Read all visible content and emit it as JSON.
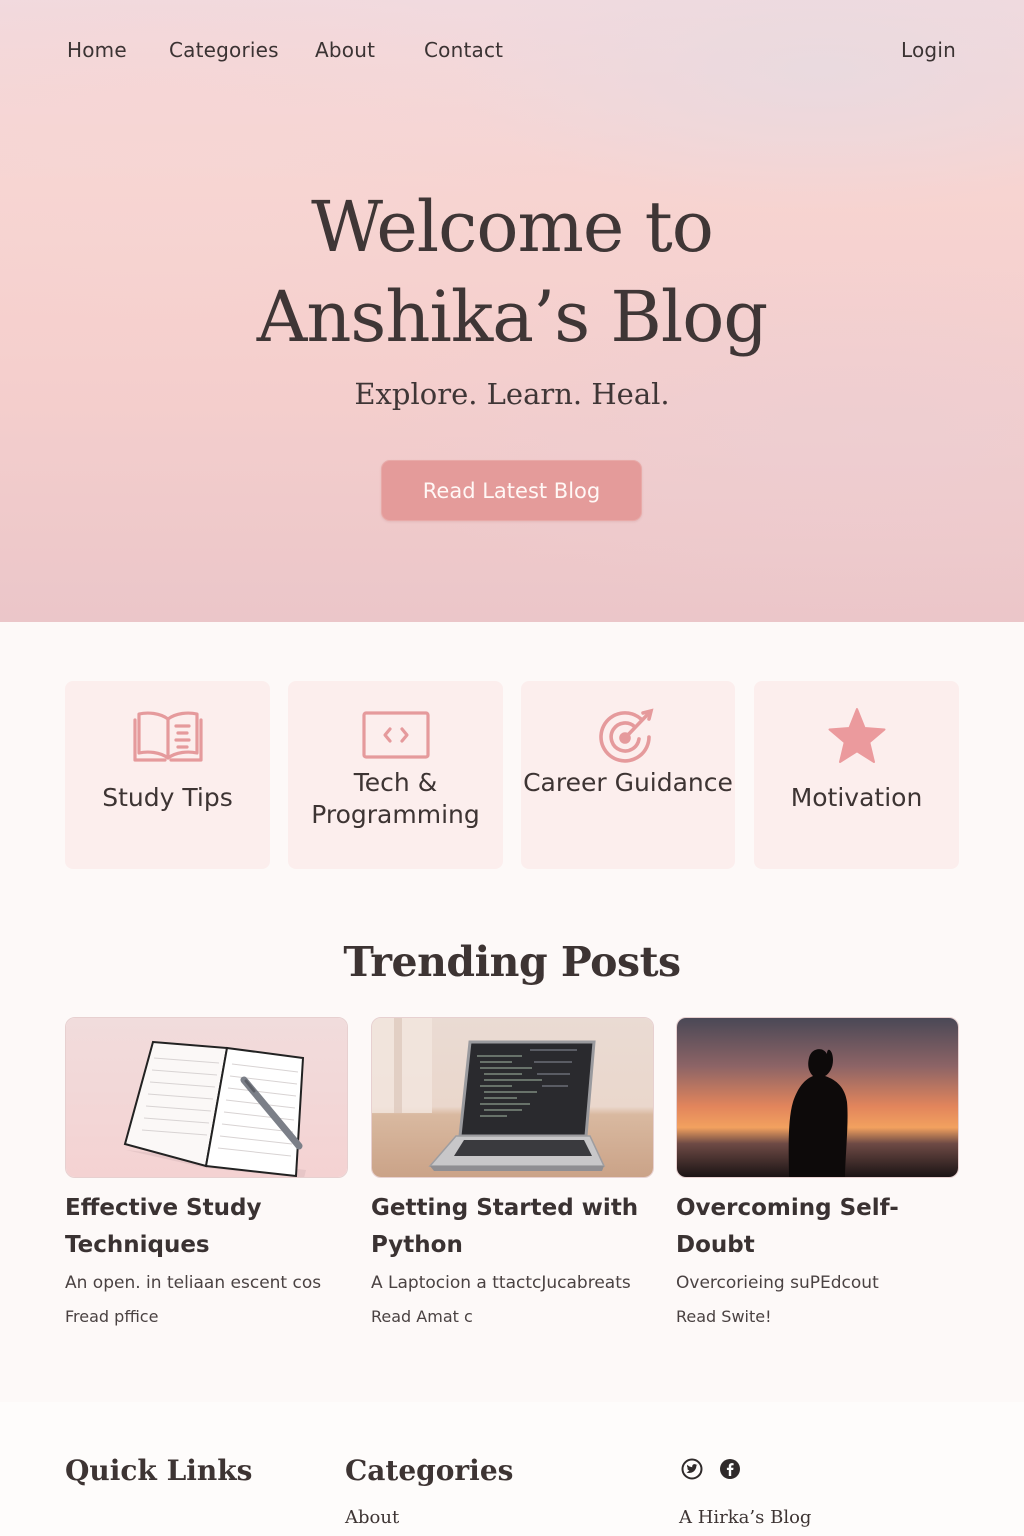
{
  "nav": {
    "items": [
      "Home",
      "Categories",
      "About",
      "Contact"
    ],
    "login": "Login"
  },
  "hero": {
    "title_line1": "Welcome to",
    "title_line2": "Anshika’s Blog",
    "subtitle": "Explore. Learn. Heal.",
    "cta": "Read Latest Blog"
  },
  "categories": [
    {
      "label": "Study Tips",
      "icon": "open-book-icon"
    },
    {
      "label": "Tech & Programming",
      "icon": "code-window-icon"
    },
    {
      "label": "Career Guidance",
      "icon": "target-arrow-icon"
    },
    {
      "label": "Motivation",
      "icon": "star-icon"
    }
  ],
  "trending": {
    "title": "Trending Posts",
    "posts": [
      {
        "title": "Effective Study Techniques",
        "excerpt": "An open. in teliaan escent cos",
        "more": "Fread pffice",
        "image": "notebook-pen-photo"
      },
      {
        "title": "Getting Started with Python",
        "excerpt": "A Laptocion a ttactcJucabreats",
        "more": "Read Amat c",
        "image": "laptop-code-photo"
      },
      {
        "title": "Overcoming Self-Doubt",
        "excerpt": "Overcorieing suPEdcout",
        "more": "Read Swite!",
        "image": "sunset-silhouette-photo"
      }
    ]
  },
  "footer": {
    "quick_links_title": "Quick Links",
    "categories_title": "Categories",
    "categories_link": "About",
    "brand": "A Hirka’s Blog",
    "social_icons": [
      "twitter-icon",
      "facebook-icon"
    ]
  },
  "colors": {
    "accent": "#e49b9a",
    "icon": "#e59a9c",
    "card_bg": "#fceeed",
    "text": "#3d3433"
  }
}
